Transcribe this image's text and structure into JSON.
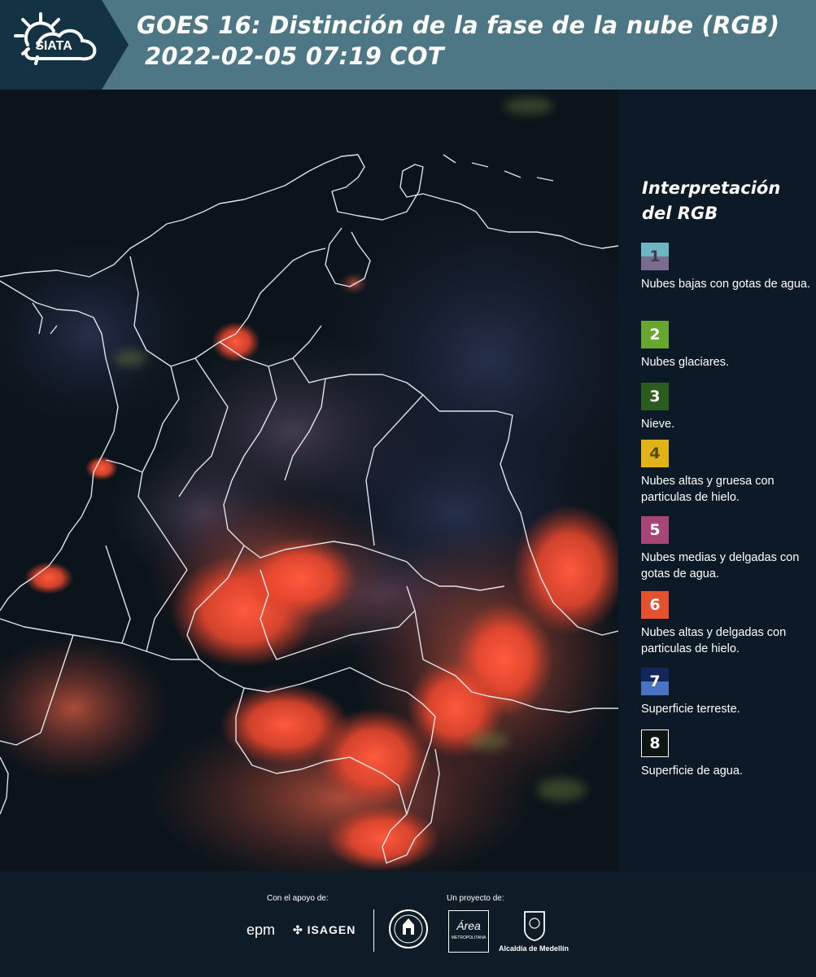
{
  "header": {
    "logo_text": "SIATA",
    "title_line1": "GOES 16: Distinción de la fase de la nube (RGB)",
    "title_line2": "2022-02-05 07:19 COT"
  },
  "legend": {
    "title_line1": "Interpretación",
    "title_line2": "del RGB",
    "items": [
      {
        "number": "1",
        "label": "Nubes bajas con gotas de agua.",
        "color_top": "#6cb7c4",
        "color_bottom": "#7b6b8c"
      },
      {
        "number": "2",
        "label": "Nubes glaciares.",
        "color": "#69a631"
      },
      {
        "number": "3",
        "label": "Nieve.",
        "color": "#2d5b1e"
      },
      {
        "number": "4",
        "label": "Nubes altas y gruesa con particulas de hielo.",
        "color": "#e0b318"
      },
      {
        "number": "5",
        "label": "Nubes medias y delgadas con gotas de agua.",
        "color": "#a54677"
      },
      {
        "number": "6",
        "label": "Nubes altas y delgadas con particulas de hielo.",
        "color": "#e5512e"
      },
      {
        "number": "7",
        "label": "Superficie terreste.",
        "color_top": "#12265c",
        "color_bottom": "#4a73c2"
      },
      {
        "number": "8",
        "label": "Superficie de agua.",
        "color": "#0b1710",
        "border": "#ffffff"
      }
    ]
  },
  "footer": {
    "support_label": "Con el apoyo de:",
    "project_label": "Un proyecto de:",
    "sponsor_epm": "epm",
    "sponsor_isagen": "ISAGEN",
    "sponsor_area": "Área",
    "sponsor_area_sub": "METROPOLITANA",
    "sponsor_alcaldia": "Alcaldía de Medellín"
  }
}
